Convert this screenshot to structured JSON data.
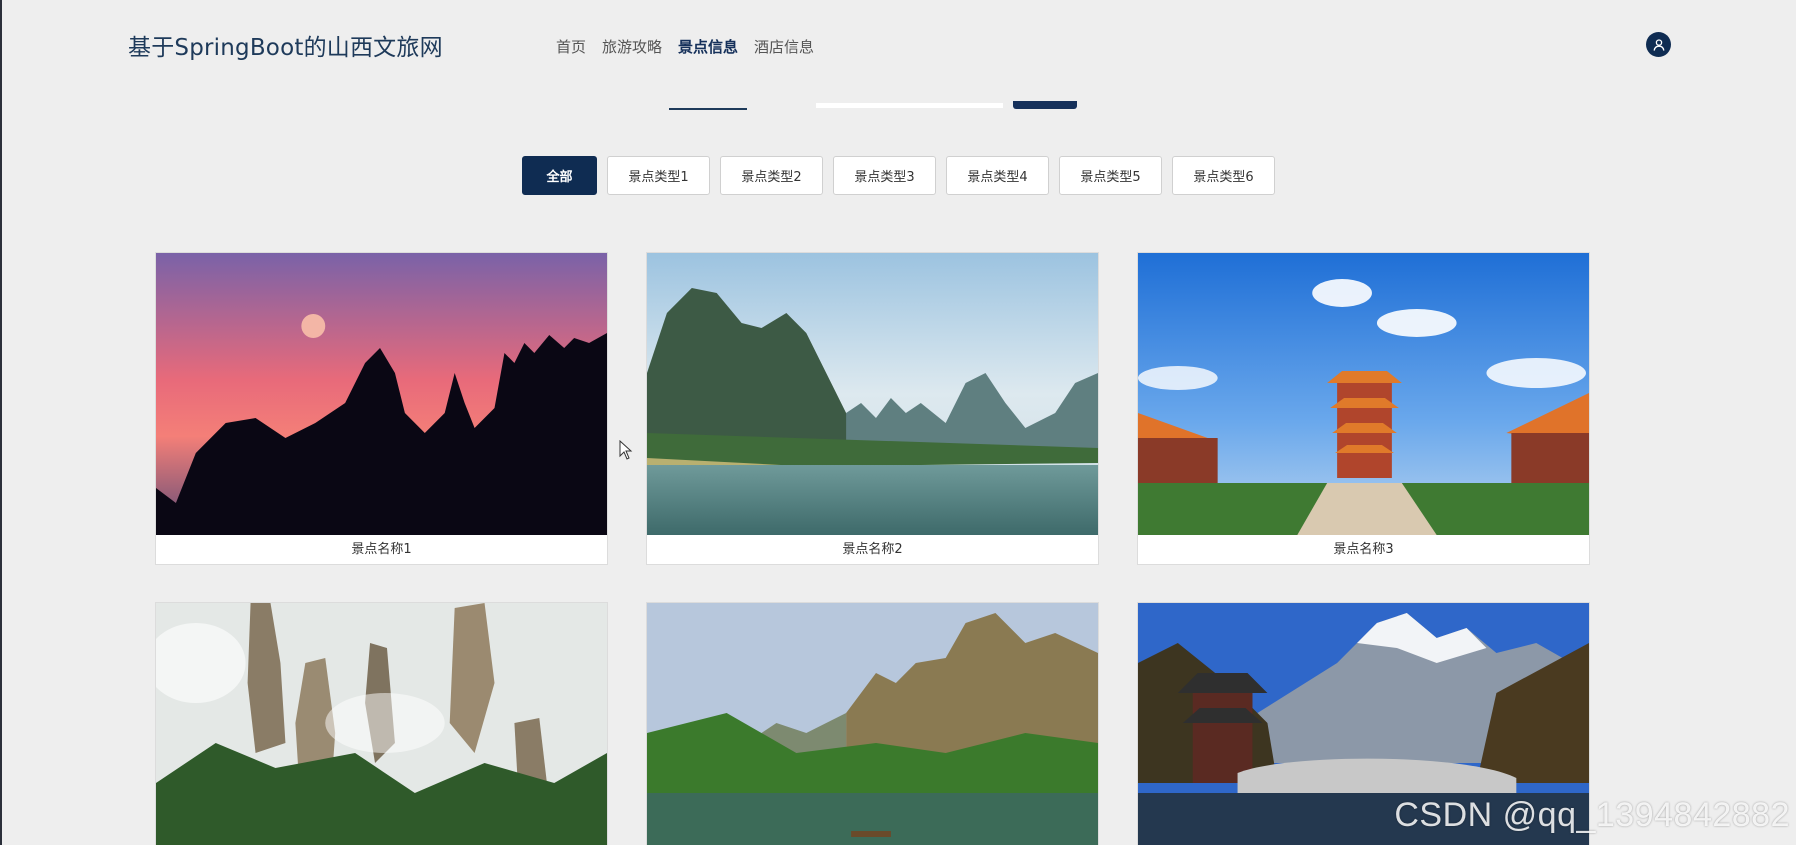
{
  "header": {
    "site_title": "基于SpringBoot的山西文旅网",
    "nav": [
      {
        "label": "首页"
      },
      {
        "label": "旅游攻略"
      },
      {
        "label": "景点信息",
        "active": true
      },
      {
        "label": "酒店信息"
      }
    ],
    "avatar_icon": "user-icon"
  },
  "filters": [
    {
      "label": "全部",
      "active": true
    },
    {
      "label": "景点类型1"
    },
    {
      "label": "景点类型2"
    },
    {
      "label": "景点类型3"
    },
    {
      "label": "景点类型4"
    },
    {
      "label": "景点类型5"
    },
    {
      "label": "景点类型6"
    }
  ],
  "cards": [
    {
      "name": "景点名称1"
    },
    {
      "name": "景点名称2"
    },
    {
      "name": "景点名称3"
    },
    {
      "name": ""
    },
    {
      "name": ""
    },
    {
      "name": ""
    }
  ],
  "watermark": "CSDN @qq_1394842882",
  "colors": {
    "primary": "#0f2c52",
    "background": "#eeeeee"
  }
}
